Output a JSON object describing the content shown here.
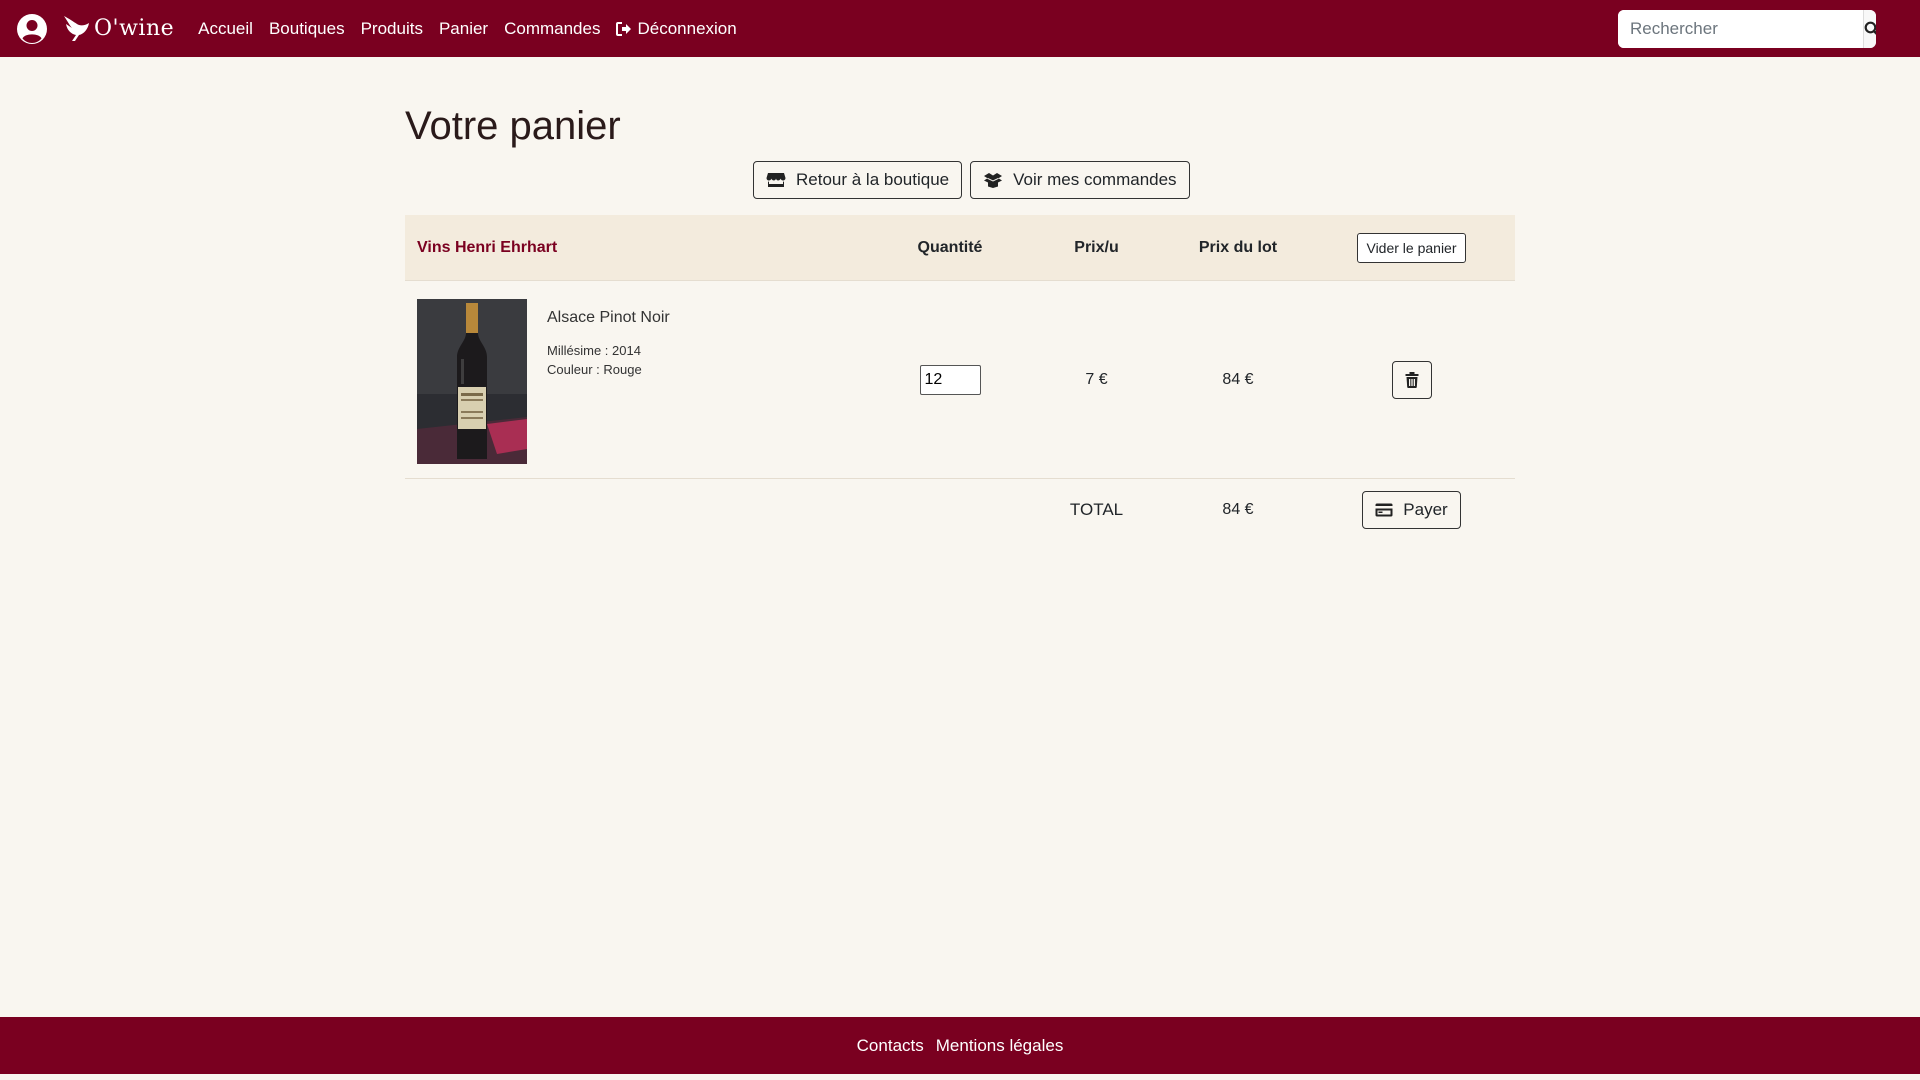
{
  "header": {
    "brand": "O'wine",
    "nav": [
      {
        "label": "Accueil"
      },
      {
        "label": "Boutiques"
      },
      {
        "label": "Produits"
      },
      {
        "label": "Panier"
      },
      {
        "label": "Commandes"
      },
      {
        "label": "Déconnexion",
        "icon": "sign-out-icon"
      }
    ],
    "search": {
      "placeholder": "Rechercher",
      "value": ""
    }
  },
  "main": {
    "title": "Votre panier",
    "back_button": "Retour à la boutique",
    "orders_button": "Voir mes commandes"
  },
  "cart": {
    "shop_name": "Vins Henri Ehrhart",
    "columns": {
      "quantity": "Quantité",
      "unit_price": "Prix/u",
      "lot_price": "Prix du lot"
    },
    "empty_button": "Vider le panier",
    "items": [
      {
        "name": "Alsace Pinot Noir",
        "vintage": "Millésime : 2014",
        "color": "Couleur : Rouge",
        "quantity": "12",
        "unit_price": "7 €",
        "lot_price": "84 €"
      }
    ],
    "total_label": "TOTAL",
    "total_value": "84 €",
    "pay_button": "Payer"
  },
  "footer": {
    "links": [
      "Contacts",
      "Mentions légales"
    ]
  },
  "colors": {
    "brand": "#7a0020",
    "background": "#f9f6f0",
    "table_head": "#f3ebdd"
  }
}
